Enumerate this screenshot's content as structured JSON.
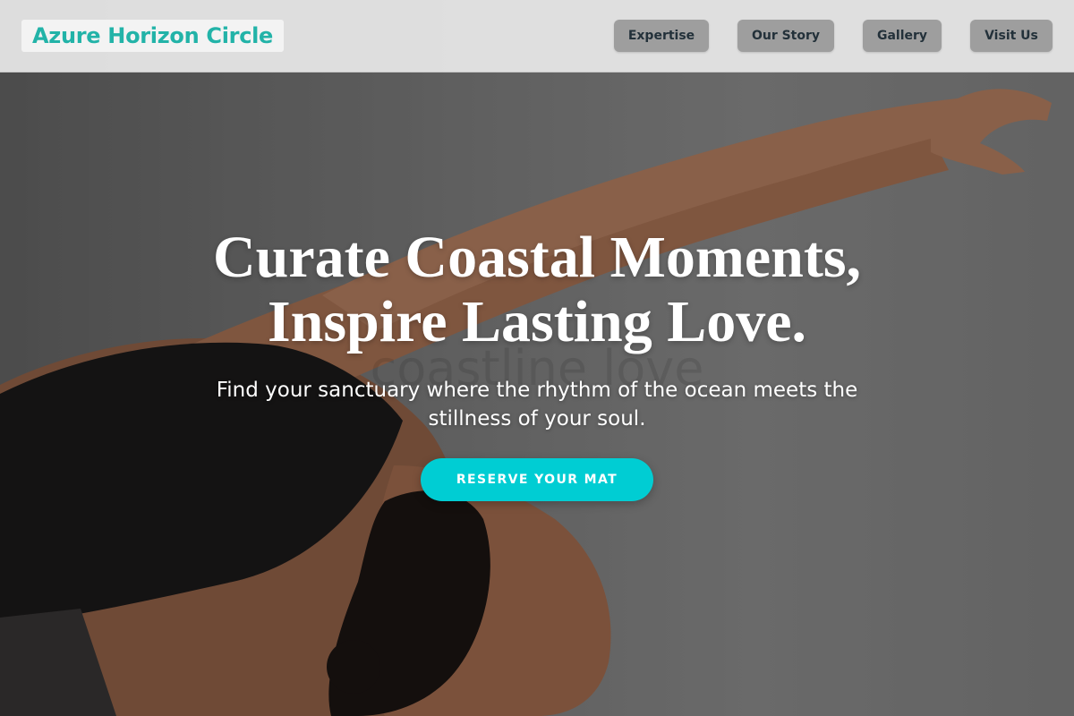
{
  "brand": {
    "name": "Azure Horizon Circle"
  },
  "nav": {
    "items": [
      {
        "label": "Expertise"
      },
      {
        "label": "Our Story"
      },
      {
        "label": "Gallery"
      },
      {
        "label": "Visit Us"
      }
    ]
  },
  "hero": {
    "headline_line1": "Curate Coastal Moments,",
    "headline_line2": "Inspire Lasting Love.",
    "watermark": "coastline love",
    "subtitle": "Find your sanctuary where the rhythm of the ocean meets the stillness of your soul.",
    "cta_label": "RESERVE YOUR MAT",
    "image": "woman-yoga-stretch-photo"
  },
  "colors": {
    "brand_text": "#22b3a8",
    "cta_background": "#00cdd3",
    "nav_button": "#9e9e9e",
    "nav_text": "#23313a"
  }
}
